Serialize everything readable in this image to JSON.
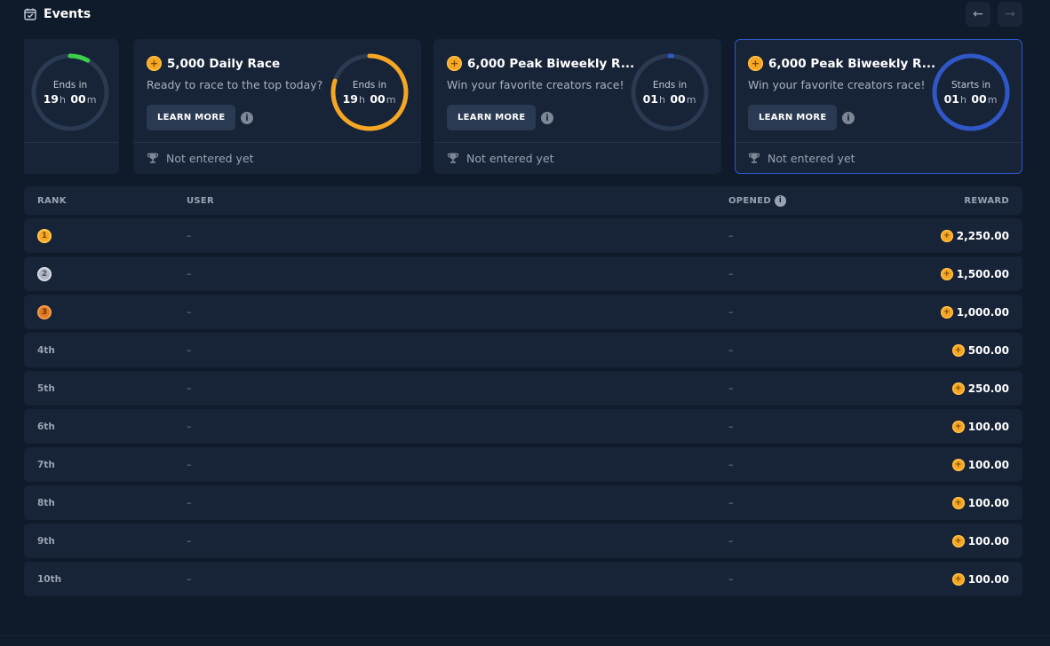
{
  "header": {
    "title": "Events",
    "prev_icon": "←",
    "next_icon": "→"
  },
  "cards": [
    {
      "ring_label": "Ends in",
      "hours": "19",
      "hours_unit": "h",
      "minutes": "00",
      "minutes_unit": "m",
      "ring_color": "#3ecf4a",
      "progress": 0.08
    },
    {
      "title": "5,000 Daily Race",
      "description": "Ready to race to the top today?",
      "button": "LEARN MORE",
      "ring_label": "Ends in",
      "hours": "19",
      "hours_unit": "h",
      "minutes": "00",
      "minutes_unit": "m",
      "ring_color": "#f5a623",
      "progress": 0.8,
      "status": "Not entered yet"
    },
    {
      "title": "6,000 Peak Biweekly R...",
      "description": "Win your favorite creators race!",
      "button": "LEARN MORE",
      "ring_label": "Ends in",
      "hours": "01",
      "hours_unit": "h",
      "minutes": "00",
      "minutes_unit": "m",
      "ring_color": "#2f57c8",
      "progress": 0.01,
      "status": "Not entered yet"
    },
    {
      "title": "6,000 Peak Biweekly R...",
      "description": "Win your favorite creators race!",
      "button": "LEARN MORE",
      "ring_label": "Starts in",
      "hours": "01",
      "hours_unit": "h",
      "minutes": "00",
      "minutes_unit": "m",
      "ring_color": "#2f57c8",
      "progress": 1.0,
      "status": "Not entered yet"
    }
  ],
  "table": {
    "headers": {
      "rank": "RANK",
      "user": "USER",
      "opened": "OPENED",
      "reward": "REWARD"
    },
    "rows": [
      {
        "rank": "1",
        "medal": "gold",
        "user": "–",
        "opened": "–",
        "reward": "2,250.00"
      },
      {
        "rank": "2",
        "medal": "silver",
        "user": "–",
        "opened": "–",
        "reward": "1,500.00"
      },
      {
        "rank": "3",
        "medal": "bronze",
        "user": "–",
        "opened": "–",
        "reward": "1,000.00"
      },
      {
        "rank": "4th",
        "user": "–",
        "opened": "–",
        "reward": "500.00"
      },
      {
        "rank": "5th",
        "user": "–",
        "opened": "–",
        "reward": "250.00"
      },
      {
        "rank": "6th",
        "user": "–",
        "opened": "–",
        "reward": "100.00"
      },
      {
        "rank": "7th",
        "user": "–",
        "opened": "–",
        "reward": "100.00"
      },
      {
        "rank": "8th",
        "user": "–",
        "opened": "–",
        "reward": "100.00"
      },
      {
        "rank": "9th",
        "user": "–",
        "opened": "–",
        "reward": "100.00"
      },
      {
        "rank": "10th",
        "user": "–",
        "opened": "–",
        "reward": "100.00"
      }
    ]
  },
  "colors": {
    "background": "#0f1a2a",
    "card": "#172336",
    "accent_gold": "#f5a623",
    "accent_blue": "#2f57c8",
    "accent_green": "#3ecf4a"
  }
}
